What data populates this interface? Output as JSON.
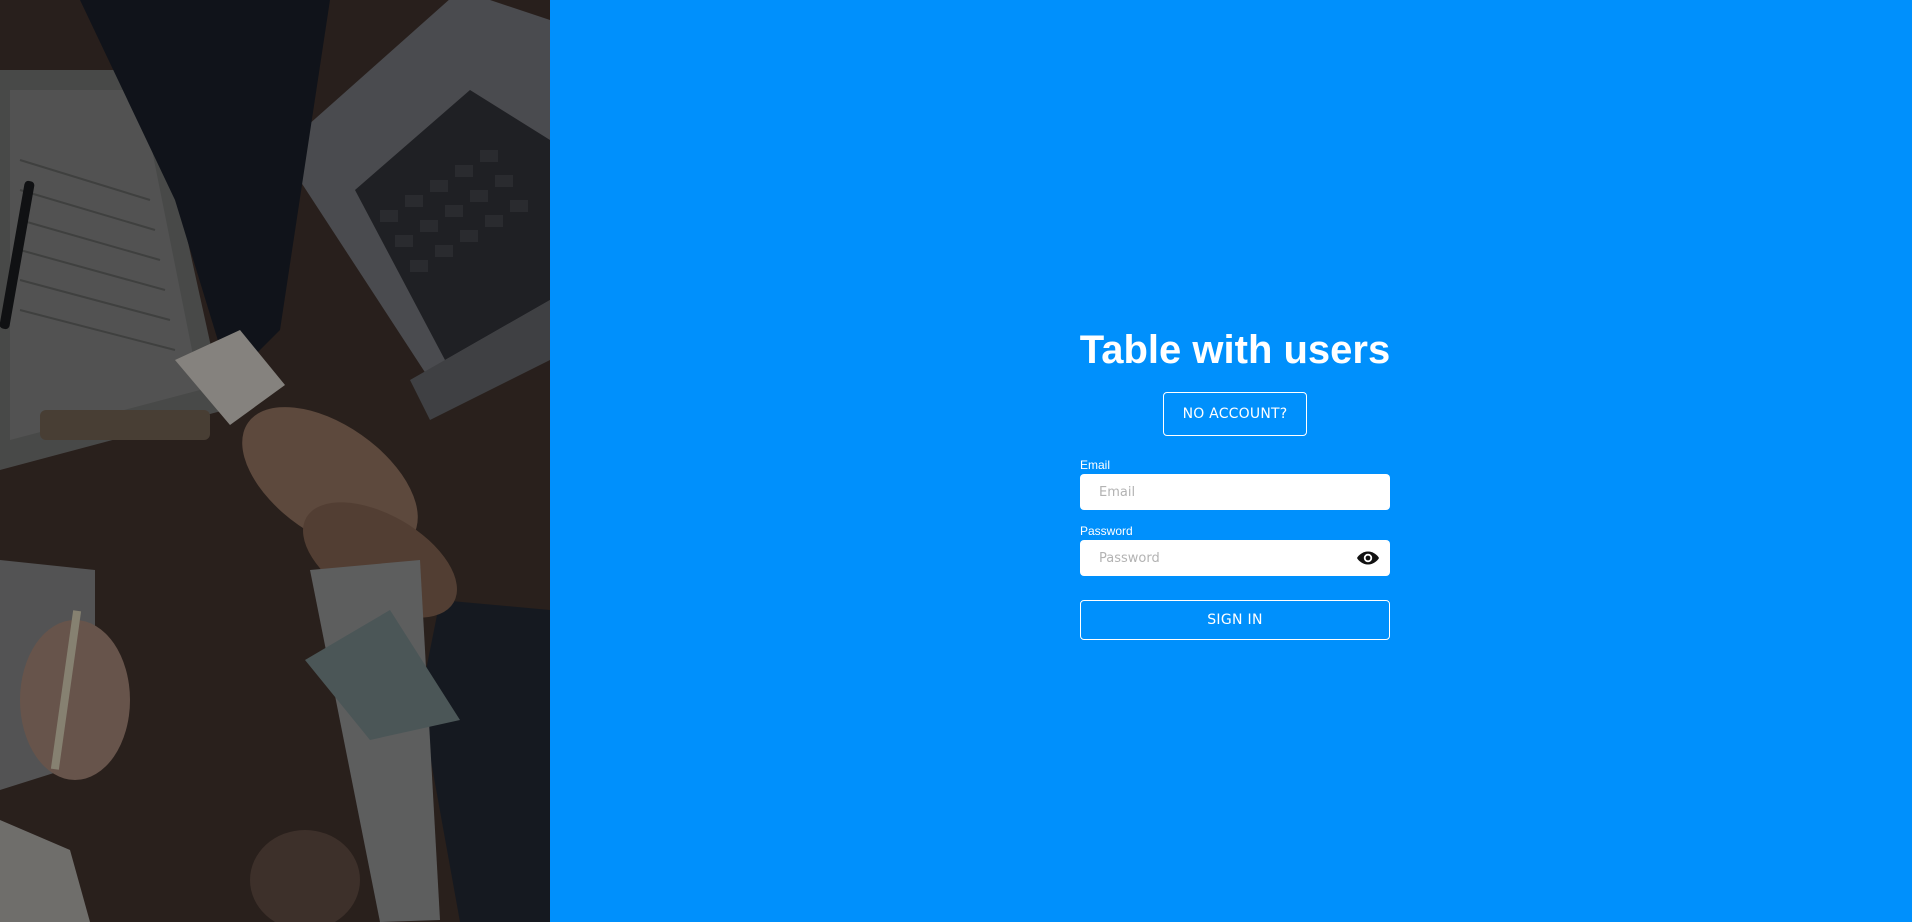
{
  "app": {
    "title": "Table with users"
  },
  "colors": {
    "accent": "#0090fc",
    "text": "#ffffff",
    "input_bg": "#ffffff"
  },
  "hero_image": {
    "description_icon": "handshake-photo"
  },
  "actions": {
    "no_account_label": "NO ACCOUNT?",
    "sign_in_label": "SIGN IN"
  },
  "form": {
    "email": {
      "label": "Email",
      "placeholder": "Email",
      "value": ""
    },
    "password": {
      "label": "Password",
      "placeholder": "Password",
      "value": "",
      "toggle_icon": "eye-icon"
    }
  }
}
